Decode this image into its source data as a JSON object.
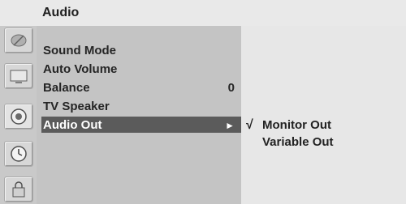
{
  "header": {
    "title": "Audio"
  },
  "sidebar_icons": [
    {
      "name": "satellite-icon"
    },
    {
      "name": "tv-screen-icon"
    },
    {
      "name": "speaker-icon"
    },
    {
      "name": "clock-icon"
    },
    {
      "name": "lock-icon"
    }
  ],
  "menu": {
    "items": [
      {
        "label": "Sound Mode",
        "value": ""
      },
      {
        "label": "Auto Volume",
        "value": ""
      },
      {
        "label": "Balance",
        "value": "0"
      },
      {
        "label": "TV Speaker",
        "value": ""
      },
      {
        "label": "Audio Out",
        "value": "",
        "arrow": "►",
        "selected": true
      }
    ]
  },
  "submenu": {
    "check_mark": "√",
    "options": [
      {
        "label": "Monitor Out",
        "checked": true
      },
      {
        "label": "Variable Out",
        "checked": false
      }
    ]
  }
}
